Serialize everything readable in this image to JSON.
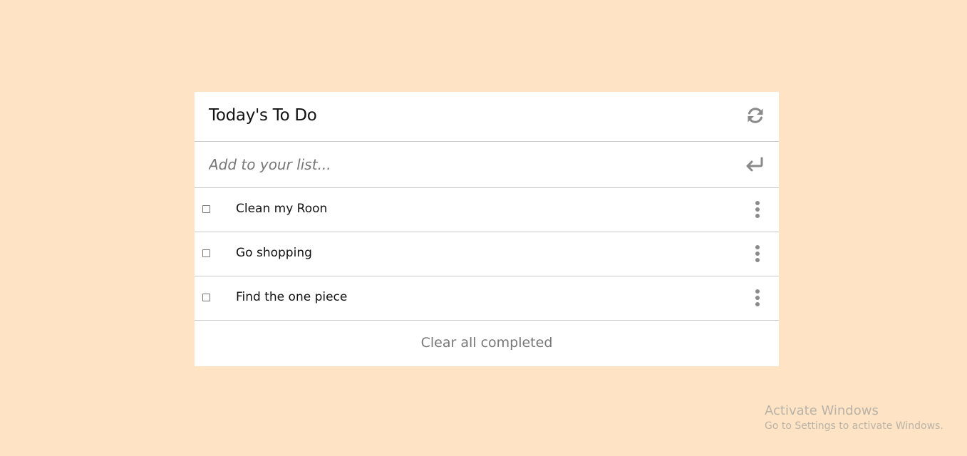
{
  "app": {
    "title": "Today's To Do",
    "refresh_icon": "refresh-icon"
  },
  "add": {
    "placeholder": "Add to your list...",
    "value": "",
    "submit_icon": "enter-icon"
  },
  "todos": [
    {
      "text": "Clean my Roon",
      "completed": false
    },
    {
      "text": "Go shopping",
      "completed": false
    },
    {
      "text": "Find the one piece",
      "completed": false
    }
  ],
  "footer": {
    "clear_label": "Clear all completed"
  },
  "watermark": {
    "title": "Activate Windows",
    "subtitle": "Go to Settings to activate Windows."
  },
  "colors": {
    "background": "#fee4c4",
    "card": "#ffffff",
    "divider": "#c8c8c8",
    "muted_text": "#777777"
  }
}
